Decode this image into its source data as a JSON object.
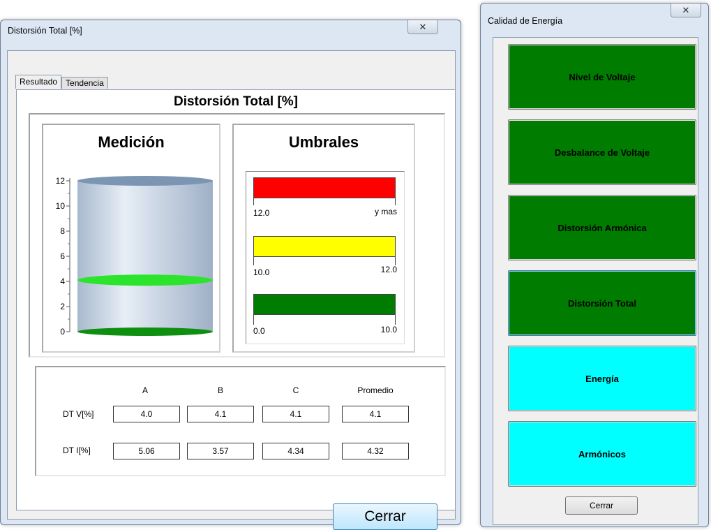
{
  "distortion_window": {
    "title": "Distorsión Total [%]",
    "tabs": [
      {
        "label": "Resultado",
        "active": true
      },
      {
        "label": "Tendencia",
        "active": false
      }
    ],
    "heading": "Distorsión Total [%]",
    "medicion": {
      "title": "Medición",
      "axis_ticks": [
        "12",
        "10",
        "8",
        "6",
        "4",
        "2",
        "0"
      ],
      "gauge": {
        "value": 4.1,
        "max": 12,
        "fill_color": "#1a9a1a",
        "tank_color": "#b8c8dc"
      }
    },
    "umbrales": {
      "title": "Umbrales",
      "bands": [
        {
          "color": "#ff0000",
          "low": "12.0",
          "high": "y mas"
        },
        {
          "color": "#ffff00",
          "low": "10.0",
          "high": "12.0"
        },
        {
          "color": "#007c00",
          "low": "0.0",
          "high": "10.0"
        }
      ]
    },
    "results": {
      "columns": [
        "A",
        "B",
        "C",
        "Promedio"
      ],
      "rows": [
        {
          "label": "DT V[%]",
          "values": [
            "4.0",
            "4.1",
            "4.1",
            "4.1"
          ]
        },
        {
          "label": "DT I[%]",
          "values": [
            "5.06",
            "3.57",
            "4.34",
            "4.32"
          ]
        }
      ]
    },
    "close_label": "Cerrar"
  },
  "quality_window": {
    "title": "Calidad de Energía",
    "buttons": [
      {
        "label": "Nivel de Voltaje",
        "color": "green"
      },
      {
        "label": "Desbalance de Voltaje",
        "color": "green"
      },
      {
        "label": "Distorsión Armónica",
        "color": "green"
      },
      {
        "label": "Distorsión Total",
        "color": "green",
        "focused": true
      },
      {
        "label": "Energía",
        "color": "cyan"
      },
      {
        "label": "Armónicos",
        "color": "cyan"
      }
    ],
    "close_label": "Cerrar"
  }
}
